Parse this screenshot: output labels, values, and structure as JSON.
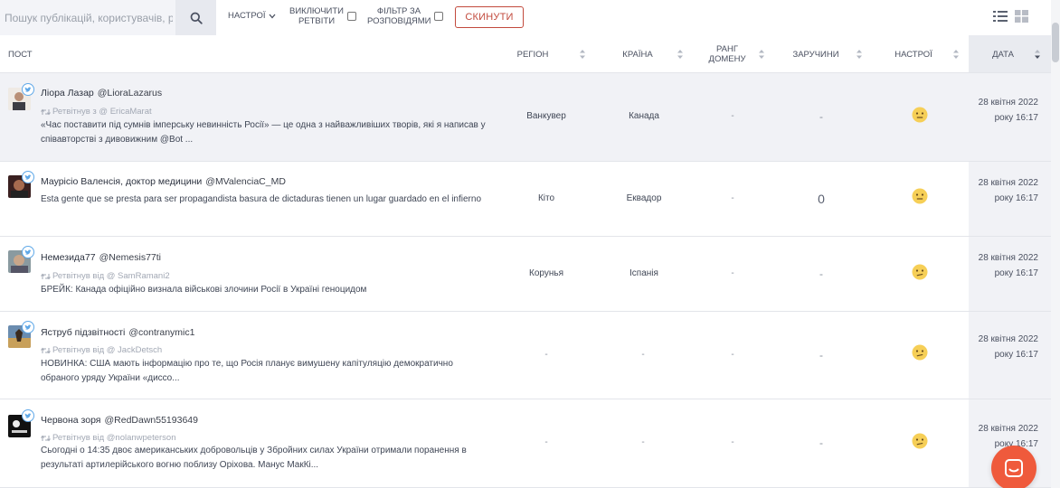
{
  "toolbar": {
    "search_placeholder": "Пошук публікацій, користувачів, р",
    "mood_label": "НАСТРОЇ",
    "retweets_label": "ВИКЛЮЧИТИ РЕТВІТИ",
    "fact_filter_label": "ФІЛЬТР ЗА РОЗПОВІДЯМИ",
    "reset_label": "СКИНУТИ",
    "icons": [
      "search-icon",
      "chevron-down-icon",
      "list-view-icon",
      "grid-view-icon"
    ]
  },
  "columns": {
    "post": "ПОСТ",
    "region": "РЕГІОН",
    "country": "КРАЇНА",
    "domain_rank": "РАНГ ДОМЕНУ",
    "reasons": "ЗАРУЧИНИ",
    "mood": "НАСТРОЇ",
    "date": "ДАТА"
  },
  "rows": [
    {
      "author": "Ліора Лазар",
      "handle": "@LioraLazarus",
      "retweet": "Ретвітнув з @ EricaMarat",
      "text": "«Час поставити під сумнів імперську невинність Росії» — це одна з найважливіших творів, які я написав у співавторстві з дивовижним @Bot ...",
      "region": "Ванкувер",
      "country": "Канада",
      "rank": "-",
      "engagement": "-",
      "mood": "neutral-face",
      "date": "28 квітня 2022 року 16:17"
    },
    {
      "author": "Маурісіо Валенсія, доктор медицини",
      "handle": "@MValenciaC_MD",
      "retweet": "",
      "text": "Esta gente que se presta para ser propagandista basura de dictaduras tienen un lugar guardado en el infierno",
      "region": "Кіто",
      "country": "Еквадор",
      "rank": "-",
      "engagement": "0",
      "mood": "neutral-face",
      "date": "28 квітня 2022 року 16:17"
    },
    {
      "author": "Немезида77",
      "handle": "@Nemesis77ti",
      "retweet": "Ретвітнув від @ SamRamani2",
      "text": "БРЕЙК: Канада офіційно визнала військові злочини Росії в Україні геноцидом",
      "region": "Корунья",
      "country": "Іспанія",
      "rank": "-",
      "engagement": "-",
      "mood": "confused-face",
      "date": "28 квітня 2022 року 16:17"
    },
    {
      "author": "Яструб підзвітності",
      "handle": "@contranymic1",
      "retweet": "Ретвітнув від @ JackDetsch",
      "text": "НОВИНКА: США мають інформацію про те, що Росія планує вимушену капітуляцію демократично обраного уряду України «дисcо...",
      "region": "-",
      "country": "-",
      "rank": "-",
      "engagement": "-",
      "mood": "confused-face",
      "date": "28 квітня 2022 року 16:17"
    },
    {
      "author": "Червона зоря",
      "handle": "@RedDawn55193649",
      "retweet": "Ретвітнув від @nolanwpeterson",
      "text": "Сьогодні о 14:35 двоє американських добровольців у Збройних силах України отримали поранення в результаті артилерійського вогню поблизу Оріхова. Манус МакКі...",
      "region": "-",
      "country": "-",
      "rank": "-",
      "engagement": "-",
      "mood": "confused-face",
      "date": "28 квітня 2022 року 16:17"
    }
  ],
  "colors": {
    "accent_red": "#c24a3d",
    "chat_button": "#ef5a3c",
    "twitter_blue": "#5fa8e8",
    "emoji_yellow": "#f6cf57"
  }
}
